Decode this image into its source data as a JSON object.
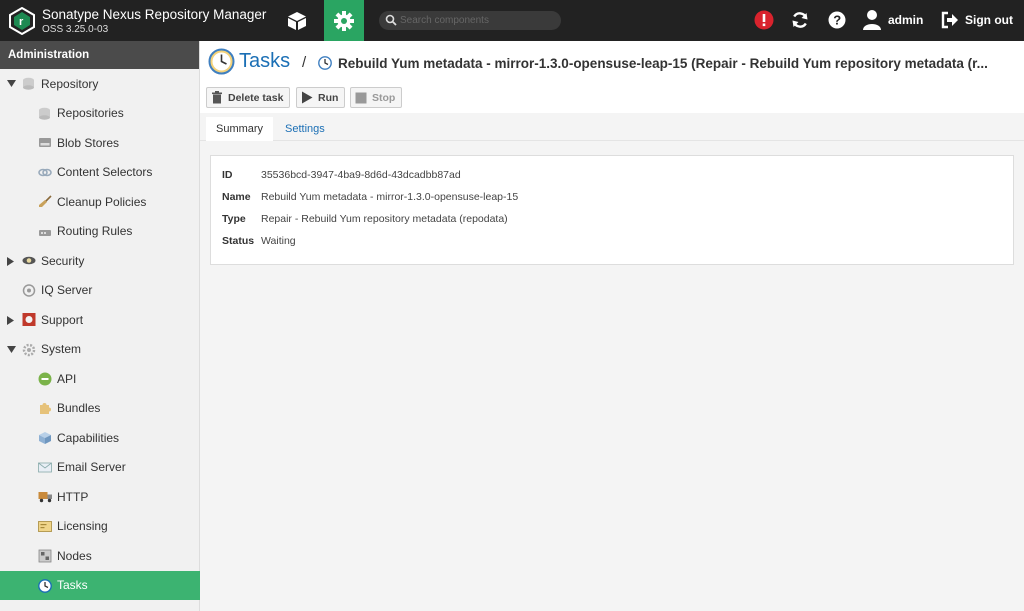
{
  "header": {
    "app_title": "Sonatype Nexus Repository Manager",
    "version": "OSS 3.25.0-03",
    "search_placeholder": "Search components",
    "user": "admin",
    "signout": "Sign out",
    "accent_color": "#2aa562"
  },
  "sidebar": {
    "title": "Administration",
    "items": [
      {
        "label": "Repository",
        "level": 0,
        "arrow": "expanded",
        "icon": "database-icon"
      },
      {
        "label": "Repositories",
        "level": 1,
        "icon": "database-icon"
      },
      {
        "label": "Blob Stores",
        "level": 1,
        "icon": "drive-icon"
      },
      {
        "label": "Content Selectors",
        "level": 1,
        "icon": "link-icon"
      },
      {
        "label": "Cleanup Policies",
        "level": 1,
        "icon": "broom-icon"
      },
      {
        "label": "Routing Rules",
        "level": 1,
        "icon": "router-icon"
      },
      {
        "label": "Security",
        "level": 0,
        "arrow": "collapsed",
        "icon": "eye-icon"
      },
      {
        "label": "IQ Server",
        "level": 0,
        "icon": "iq-icon"
      },
      {
        "label": "Support",
        "level": 0,
        "arrow": "collapsed",
        "icon": "lifebuoy-icon"
      },
      {
        "label": "System",
        "level": 0,
        "arrow": "expanded",
        "icon": "cog-icon"
      },
      {
        "label": "API",
        "level": 1,
        "icon": "api-icon"
      },
      {
        "label": "Bundles",
        "level": 1,
        "icon": "puzzle-icon"
      },
      {
        "label": "Capabilities",
        "level": 1,
        "icon": "cube-icon"
      },
      {
        "label": "Email Server",
        "level": 1,
        "icon": "envelope-icon"
      },
      {
        "label": "HTTP",
        "level": 1,
        "icon": "truck-icon"
      },
      {
        "label": "Licensing",
        "level": 1,
        "icon": "license-icon"
      },
      {
        "label": "Nodes",
        "level": 1,
        "icon": "nodes-icon"
      },
      {
        "label": "Tasks",
        "level": 1,
        "icon": "clock-icon",
        "active": true
      }
    ]
  },
  "main": {
    "title": "Tasks",
    "breadcrumb": "Rebuild Yum metadata - mirror-1.3.0-opensuse-leap-15 (Repair - Rebuild Yum repository metadata (r...",
    "toolbar": {
      "delete": "Delete task",
      "run": "Run",
      "stop": "Stop"
    },
    "tabs": {
      "summary": "Summary",
      "settings": "Settings"
    },
    "summary": {
      "id_label": "ID",
      "id": "35536bcd-3947-4ba9-8d6d-43dcadbb87ad",
      "name_label": "Name",
      "name": "Rebuild Yum metadata - mirror-1.3.0-opensuse-leap-15",
      "type_label": "Type",
      "type": "Repair - Rebuild Yum repository metadata (repodata)",
      "status_label": "Status",
      "status": "Waiting"
    }
  }
}
